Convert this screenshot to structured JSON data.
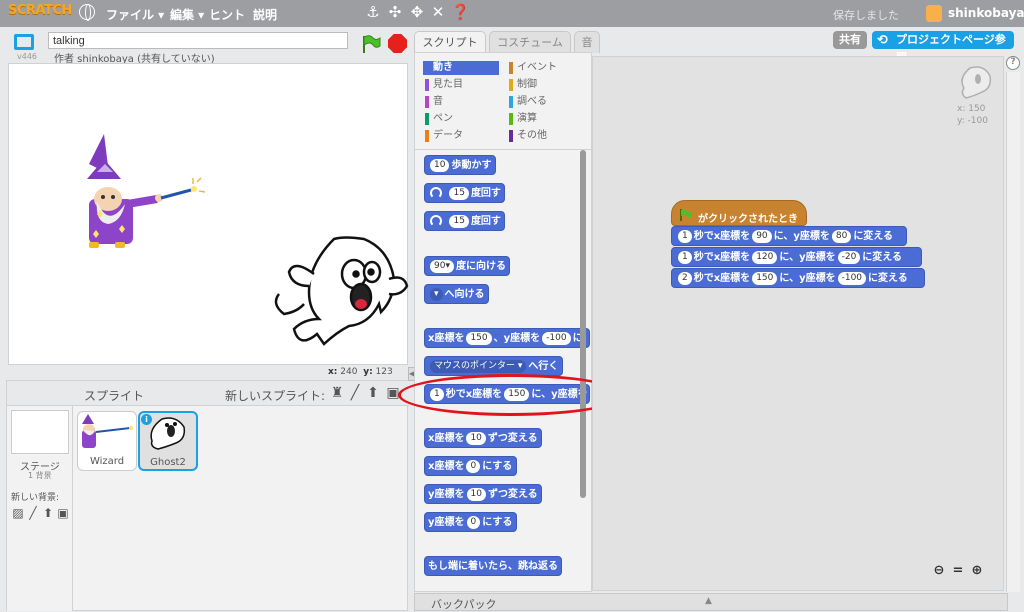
{
  "menubar": {
    "logo": "SCRATCH",
    "file": "ファイル ▾",
    "edit": "編集 ▾",
    "tips": "ヒント",
    "about": "説明",
    "saved": "保存しました",
    "user": "shinkobaya"
  },
  "stage": {
    "version": "v446",
    "project_title": "talking",
    "author": "作者 shinkobaya (共有していない)",
    "coord_x_label": "x:",
    "coord_x": "240",
    "coord_y_label": "y:",
    "coord_y": "123"
  },
  "sprites": {
    "header": "スプライト",
    "new_sprite": "新しいスプライト:",
    "stage_label": "ステージ",
    "stage_sub": "1 背景",
    "new_backdrop": "新しい背景:",
    "items": [
      {
        "name": "Wizard"
      },
      {
        "name": "Ghost2"
      }
    ]
  },
  "palette": {
    "tabs": [
      "スクリプト",
      "コスチューム",
      "音"
    ],
    "categories": [
      {
        "label": "動き",
        "color": "#4a6cd4"
      },
      {
        "label": "見た目",
        "color": "#8a55d7"
      },
      {
        "label": "音",
        "color": "#bb42c3"
      },
      {
        "label": "ペン",
        "color": "#0e9a6c"
      },
      {
        "label": "データ",
        "color": "#ee7d16"
      },
      {
        "label": "イベント",
        "color": "#c88330"
      },
      {
        "label": "制御",
        "color": "#e1a91a"
      },
      {
        "label": "調べる",
        "color": "#2ca5e2"
      },
      {
        "label": "演算",
        "color": "#5cb712"
      },
      {
        "label": "その他",
        "color": "#632d99"
      }
    ],
    "blocks": {
      "move": {
        "num": "10",
        "text": "歩動かす"
      },
      "turn_right": {
        "num": "15",
        "text": "度回す"
      },
      "turn_left": {
        "num": "15",
        "text": "度回す"
      },
      "point_dir": {
        "num": "90▾",
        "text": "度に向ける"
      },
      "point_towards": {
        "text": "へ向ける"
      },
      "goto_xy": {
        "t1": "x座標を",
        "n1": "150",
        "t2": "、y座標を",
        "n2": "-100",
        "t3": "に"
      },
      "goto_mouse": {
        "t1": "マウスのポインター ▾",
        "t2": "へ行く"
      },
      "glide": {
        "n0": "1",
        "t1": "秒でx座標を",
        "n1": "150",
        "t2": "に、y座標を"
      },
      "change_x": {
        "t1": "x座標を",
        "n1": "10",
        "t2": "ずつ変える"
      },
      "set_x": {
        "t1": "x座標を",
        "n1": "0",
        "t2": "にする"
      },
      "change_y": {
        "t1": "y座標を",
        "n1": "10",
        "t2": "ずつ変える"
      },
      "set_y": {
        "t1": "y座標を",
        "n1": "0",
        "t2": "にする"
      },
      "bounce": {
        "text": "もし端に着いたら、跳ね返る"
      }
    }
  },
  "backpack": {
    "label": "バックパック"
  },
  "scripts": {
    "share": "共有",
    "project_page": "プロジェクトページ参照",
    "corner_x": "x: 150",
    "corner_y": "y: -100",
    "hat": "がクリックされたとき",
    "glides": [
      {
        "secs": "1",
        "t1": "秒でx座標を",
        "x": "90",
        "t2": "に、y座標を",
        "y": "80",
        "t3": "に変える"
      },
      {
        "secs": "1",
        "t1": "秒でx座標を",
        "x": "120",
        "t2": "に、y座標を",
        "y": "-20",
        "t3": "に変える"
      },
      {
        "secs": "2",
        "t1": "秒でx座標を",
        "x": "150",
        "t2": "に、y座標を",
        "y": "-100",
        "t3": "に変える"
      }
    ]
  }
}
